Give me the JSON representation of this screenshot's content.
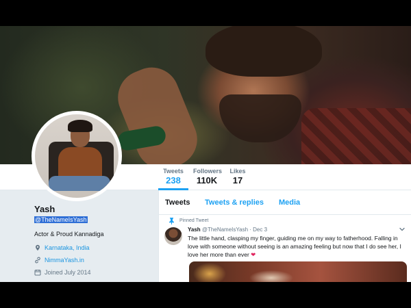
{
  "profile": {
    "name": "Yash",
    "handle": "@TheNameIsYash",
    "bio": "Actor & Proud Kannadiga",
    "location": "Karnataka, India",
    "website": "NimmaYash.in",
    "joined": "Joined July 2014"
  },
  "stats": [
    {
      "label": "Tweets",
      "value": "238"
    },
    {
      "label": "Followers",
      "value": "110K"
    },
    {
      "label": "Likes",
      "value": "17"
    }
  ],
  "tabs": [
    "Tweets",
    "Tweets & replies",
    "Media"
  ],
  "pinned_tweet": {
    "pinned_label": "Pinned Tweet",
    "name": "Yash",
    "handle_date": "@TheNameIsYash · Dec 3",
    "text": "The little hand, clasping my finger, guiding me on my way to fatherhood. Falling in love with someone without seeing is an amazing feeling but now that I do see her, I love her more than ever"
  },
  "colors": {
    "accent": "#1da1f2",
    "background": "#e6ecf0",
    "heart": "#e0245e",
    "selection": "#2f6fd6"
  },
  "icons": [
    "location-icon",
    "link-icon",
    "calendar-icon",
    "pin-icon",
    "chevron-down-icon",
    "heart-icon"
  ]
}
